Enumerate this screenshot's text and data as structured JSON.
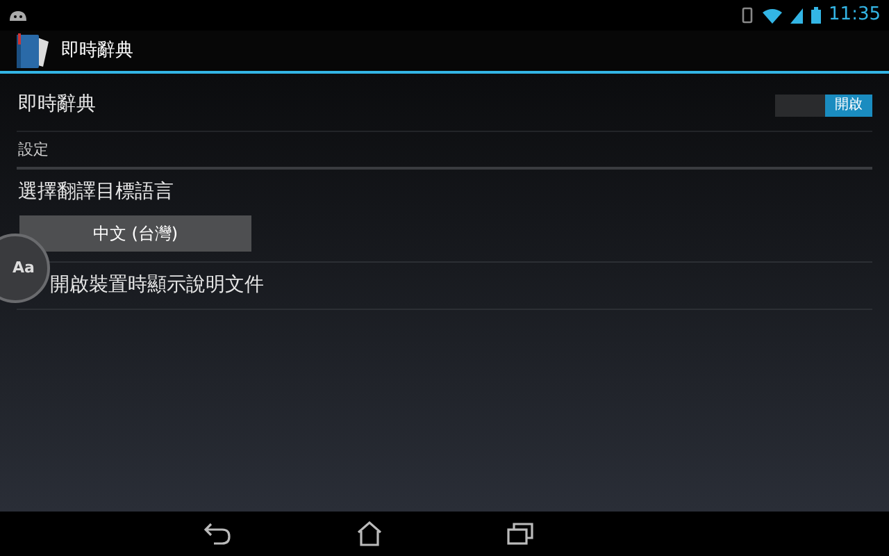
{
  "status_bar": {
    "time": "11:35"
  },
  "action_bar": {
    "title": "即時辭典"
  },
  "master_switch": {
    "label": "即時辭典",
    "on": true,
    "state_label": "開啟"
  },
  "section": {
    "title": "設定"
  },
  "items": [
    {
      "kind": "picker",
      "title": "選擇翻譯目標語言",
      "value": "中文 (台灣)"
    },
    {
      "kind": "plain",
      "title": "開啟裝置時顯示說明文件"
    }
  ],
  "floating_button": {
    "label": "Aa"
  }
}
